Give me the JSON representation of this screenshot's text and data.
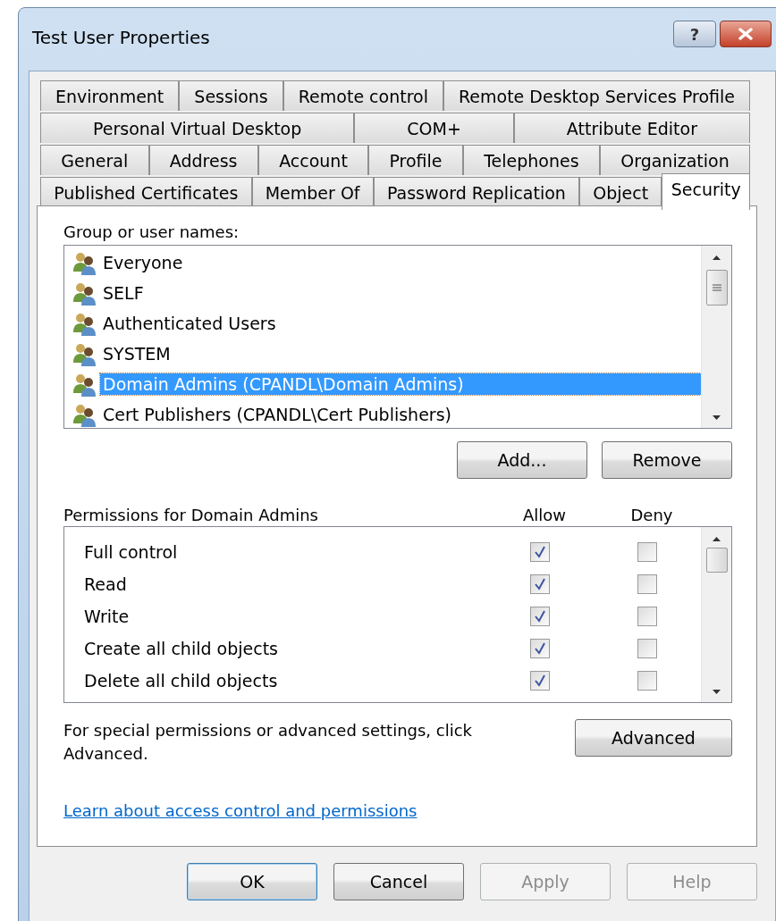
{
  "window": {
    "title": "Test User Properties",
    "help_button": "?"
  },
  "tab_rows": [
    [
      {
        "label": "Environment",
        "selected": false
      },
      {
        "label": "Sessions",
        "selected": false
      },
      {
        "label": "Remote control",
        "selected": false
      },
      {
        "label": "Remote Desktop Services Profile",
        "selected": false
      }
    ],
    [
      {
        "label": "Personal Virtual Desktop",
        "selected": false
      },
      {
        "label": "COM+",
        "selected": false
      },
      {
        "label": "Attribute Editor",
        "selected": false
      }
    ],
    [
      {
        "label": "General",
        "selected": false
      },
      {
        "label": "Address",
        "selected": false
      },
      {
        "label": "Account",
        "selected": false
      },
      {
        "label": "Profile",
        "selected": false
      },
      {
        "label": "Telephones",
        "selected": false
      },
      {
        "label": "Organization",
        "selected": false
      }
    ],
    [
      {
        "label": "Published Certificates",
        "selected": false
      },
      {
        "label": "Member Of",
        "selected": false
      },
      {
        "label": "Password Replication",
        "selected": false
      },
      {
        "label": "Object",
        "selected": false
      },
      {
        "label": "Security",
        "selected": true
      }
    ]
  ],
  "groups": {
    "label": "Group or user names:",
    "items": [
      {
        "name": "Everyone",
        "selected": false
      },
      {
        "name": "SELF",
        "selected": false
      },
      {
        "name": "Authenticated Users",
        "selected": false
      },
      {
        "name": "SYSTEM",
        "selected": false
      },
      {
        "name": "Domain Admins (CPANDL\\Domain Admins)",
        "selected": true
      },
      {
        "name": "Cert Publishers (CPANDL\\Cert Publishers)",
        "selected": false
      }
    ]
  },
  "group_buttons": [
    "Add...",
    "Remove"
  ],
  "permissions": {
    "label": "Permissions for Domain Admins",
    "columns": [
      "Allow",
      "Deny"
    ],
    "rows": [
      {
        "name": "Full control",
        "allow": true,
        "deny": false
      },
      {
        "name": "Read",
        "allow": true,
        "deny": false
      },
      {
        "name": "Write",
        "allow": true,
        "deny": false
      },
      {
        "name": "Create all child objects",
        "allow": true,
        "deny": false
      },
      {
        "name": "Delete all child objects",
        "allow": true,
        "deny": false
      }
    ]
  },
  "advanced_note": "For special permissions or advanced settings, click Advanced.",
  "advanced_button": "Advanced",
  "link": "Learn about access control and permissions",
  "dialog_buttons": [
    {
      "label": "OK",
      "disabled": false,
      "default": true
    },
    {
      "label": "Cancel",
      "disabled": false,
      "default": false
    },
    {
      "label": "Apply",
      "disabled": true,
      "default": false
    },
    {
      "label": "Help",
      "disabled": true,
      "default": false
    }
  ]
}
